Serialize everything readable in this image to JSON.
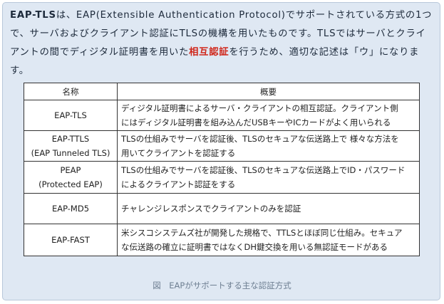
{
  "paragraph": {
    "term": "EAP-TLS",
    "text1": "は、EAP(Extensible Authentication Protocol)でサポートされている方式の1つで、サーバおよびクライアント認証にTLSの機構を用いたものです。TLSではサーバとクライアントの間でディジタル証明書を用いた",
    "highlight": "相互認証",
    "text2": "を行うため、適切な記述は「ウ」になります。"
  },
  "table": {
    "headers": [
      "名称",
      "概要"
    ],
    "rows": [
      {
        "name": [
          "EAP-TLS"
        ],
        "desc": [
          "ディジタル証明書によるサーバ・クライアントの相互認証。クライアント側",
          "にはディジタル証明書を組み込んだUSBキーやICカードがよく用いられる"
        ]
      },
      {
        "name": [
          "EAP-TTLS",
          "(EAP Tunneled TLS)"
        ],
        "desc": [
          "TLSの仕組みでサーバを認証後、TLSのセキュアな伝送路上で 様々な方法を",
          "用いてクライアントを認証する"
        ]
      },
      {
        "name": [
          "PEAP",
          "(Protected EAP)"
        ],
        "desc": [
          "TLSの仕組みでサーバを認証後、TLSのセキュアな伝送路上でID・パスワード",
          "によるクライアント認証をする"
        ]
      },
      {
        "name": [
          "EAP-MD5"
        ],
        "desc": [
          "チャレンジレスポンスでクライアントのみを認証"
        ]
      },
      {
        "name": [
          "EAP-FAST"
        ],
        "desc": [
          "米シスコシステムズ社が開発した規格で、TTLSとほぼ同じ仕組み。セキュア",
          "な伝送路の確立に証明書ではなくDH鍵交換を用いる無認証モードがある"
        ]
      }
    ]
  },
  "caption": "図　EAPがサポートする主な認証方式"
}
